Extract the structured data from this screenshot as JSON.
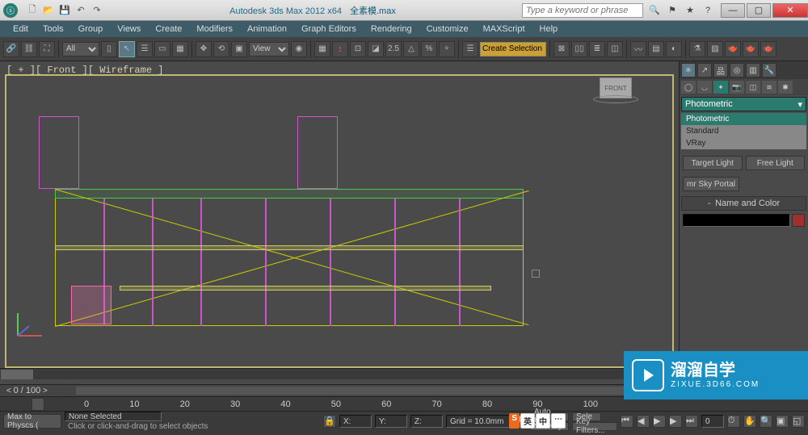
{
  "titlebar": {
    "app": "Autodesk 3ds Max  2012 x64",
    "doc": "全素模.max",
    "search_placeholder": "Type a keyword or phrase"
  },
  "menus": [
    "Edit",
    "Tools",
    "Group",
    "Views",
    "Create",
    "Modifiers",
    "Animation",
    "Graph Editors",
    "Rendering",
    "Customize",
    "MAXScript",
    "Help"
  ],
  "toolbar": {
    "all_label": "All",
    "view_label": "View",
    "xform_label": "2.5",
    "selset_label": "Create Selection Set"
  },
  "viewport": {
    "label": "[ + ][ Front ][ Wireframe ]",
    "viewcube_face": "FRONT",
    "frame_display": "0 / 100"
  },
  "panel": {
    "dropdown_label": "Photometric",
    "options": [
      "Photometric",
      "Standard",
      "VRay"
    ],
    "btn_target": "Target Light",
    "btn_free": "Free Light",
    "btn_sky": "mr Sky Portal",
    "rollout_name": "Name and Color",
    "minus": "-"
  },
  "timeline": {
    "ticks": [
      "0",
      "10",
      "20",
      "30",
      "40",
      "50",
      "60",
      "70",
      "80",
      "90",
      "100"
    ],
    "selection": "None Selected",
    "grid": "Grid = 10.0mm",
    "x": "X:",
    "y": "Y:",
    "z": "Z:",
    "max2phys": "Max to Physcs (",
    "prompt": "Click or click-and-drag to select objects",
    "autokey": "Auto Key",
    "setkey": "Set Key",
    "selected": "Sele",
    "keyfilters": "Key Filters..."
  },
  "watermark": {
    "big": "溜溜自学",
    "small": "ZIXUE.3D66.COM"
  },
  "ime": {
    "logo": "S",
    "cn": "英",
    "half": "中"
  }
}
